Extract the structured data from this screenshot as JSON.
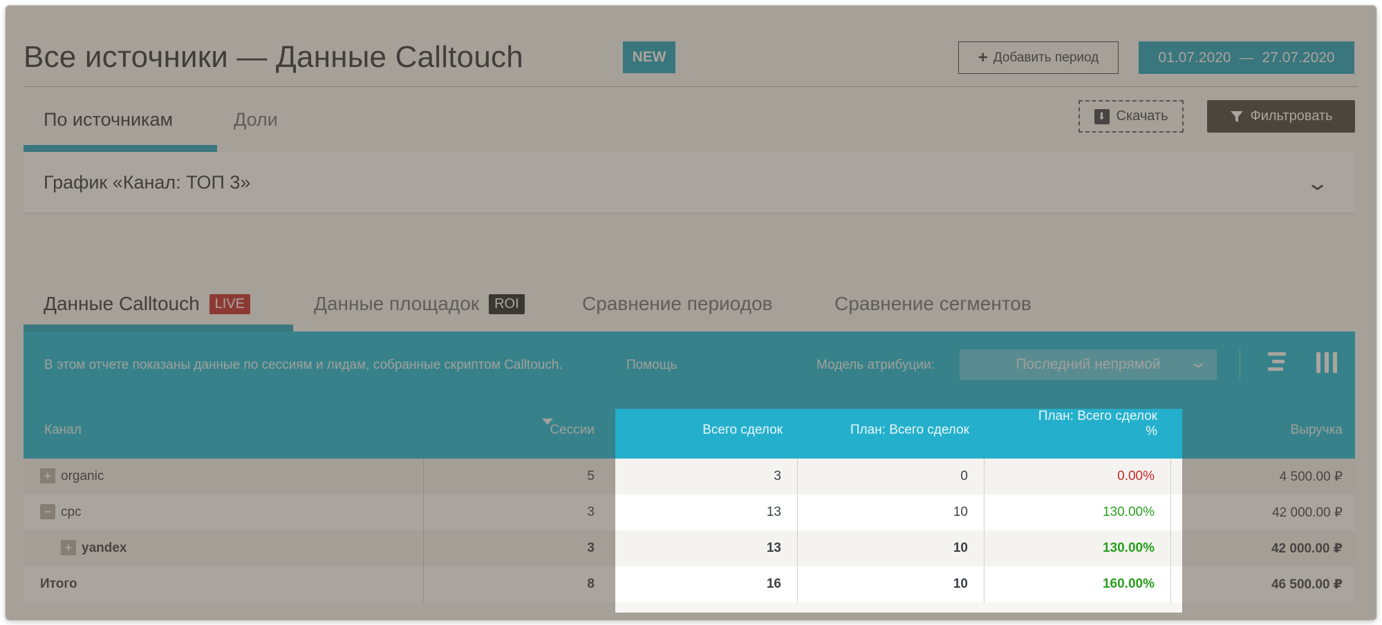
{
  "header": {
    "title": "Все источники — Данные Calltouch",
    "new_badge": "NEW",
    "add_period_label": "Добавить период",
    "date_from": "01.07.2020",
    "date_sep": "—",
    "date_to": "27.07.2020"
  },
  "top_tabs": [
    {
      "label": "По источникам",
      "active": true
    },
    {
      "label": "Доли",
      "active": false
    }
  ],
  "actions": {
    "download_label": "Скачать",
    "filter_label": "Фильтровать"
  },
  "chart_panel": {
    "label": "График «Канал: ТОП 3»"
  },
  "data_tabs": [
    {
      "label": "Данные Calltouch",
      "badge": "LIVE",
      "active": true
    },
    {
      "label": "Данные площадок",
      "badge": "ROI",
      "active": false
    },
    {
      "label": "Сравнение периодов",
      "active": false
    },
    {
      "label": "Сравнение сегментов",
      "active": false
    }
  ],
  "report": {
    "info_text": "В этом отчете показаны данные по сессиям и лидам, собранные скриптом Calltouch.",
    "help_label": "Помощь",
    "attribution_label": "Модель атрибуции:",
    "attribution_value": "Последний непрямой"
  },
  "table": {
    "headers": {
      "channel": "Канал",
      "sessions": "Сессии",
      "deals": "Всего сделок",
      "plan_deals": "План: Всего сделок",
      "plan_deals_pct_line1": "План: Всего сделок",
      "plan_deals_pct_line2": "%",
      "revenue": "Выручка"
    },
    "rows": [
      {
        "channel": "organic",
        "sessions": "5",
        "deals": "3",
        "plan_deals": "0",
        "plan_pct": "0.00%",
        "revenue": "4 500.00 ₽",
        "expander": "+"
      },
      {
        "channel": "cpc",
        "sessions": "3",
        "deals": "13",
        "plan_deals": "10",
        "plan_pct": "130.00%",
        "revenue": "42 000.00 ₽",
        "expander": "−"
      },
      {
        "channel": "yandex",
        "sessions": "3",
        "deals": "13",
        "plan_deals": "10",
        "plan_pct": "130.00%",
        "revenue": "42 000.00 ₽",
        "expander": "+"
      },
      {
        "channel": "Итого",
        "sessions": "8",
        "deals": "16",
        "plan_deals": "10",
        "plan_pct": "160.00%",
        "revenue": "46 500.00 ₽"
      }
    ]
  },
  "colors": {
    "accent": "#1ea2bd",
    "report_bg": "#1bbad6",
    "negative": "#c62829",
    "positive": "#2a9f1e"
  }
}
